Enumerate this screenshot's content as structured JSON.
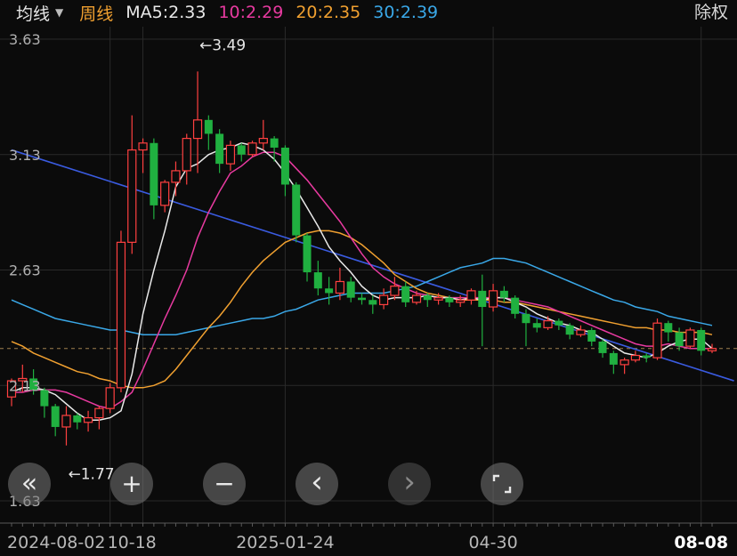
{
  "header": {
    "mode_label": "均线",
    "period_label": "周线",
    "ma_items": [
      {
        "label": "MA5:2.33",
        "color": "#e9e9e9"
      },
      {
        "label": "10:2.29",
        "color": "#e83aa0"
      },
      {
        "label": "20:2.35",
        "color": "#f0a030"
      },
      {
        "label": "30:2.39",
        "color": "#3aa8e8"
      }
    ],
    "adjust_label": "除权"
  },
  "chart_data": {
    "type": "candlestick",
    "y_ticks": [
      "3.63",
      "3.13",
      "2.63",
      "2.13",
      "1.63"
    ],
    "ylim": [
      1.63,
      3.63
    ],
    "x_labels": [
      "2024-08-02",
      "10-18",
      "2025-01-24",
      "04-30",
      "08-08"
    ],
    "annotations": [
      {
        "text": "←3.49",
        "value": 3.49
      },
      {
        "text": "←1.77",
        "value": 1.77
      }
    ],
    "reference_line": 2.29,
    "colors": {
      "up": "#ff4040",
      "down": "#20b040",
      "grid": "#2a2a2a"
    },
    "candles": [
      [
        2.08,
        2.15,
        2.16,
        2.04
      ],
      [
        2.15,
        2.16,
        2.22,
        2.1
      ],
      [
        2.16,
        2.11,
        2.2,
        2.09
      ],
      [
        2.11,
        2.04,
        2.12,
        1.99
      ],
      [
        2.04,
        1.95,
        2.05,
        1.91
      ],
      [
        1.95,
        2.0,
        2.04,
        1.87
      ],
      [
        2.0,
        1.97,
        2.01,
        1.94
      ],
      [
        1.97,
        1.99,
        2.02,
        1.93
      ],
      [
        1.99,
        2.03,
        2.04,
        1.94
      ],
      [
        2.03,
        2.12,
        2.14,
        2.01
      ],
      [
        2.12,
        2.75,
        2.8,
        2.1
      ],
      [
        2.75,
        3.15,
        3.3,
        2.7
      ],
      [
        3.15,
        3.18,
        3.2,
        3.05
      ],
      [
        3.18,
        2.91,
        3.2,
        2.85
      ],
      [
        2.91,
        3.01,
        3.02,
        2.88
      ],
      [
        3.01,
        3.06,
        3.1,
        2.95
      ],
      [
        3.06,
        3.2,
        3.22,
        3.0
      ],
      [
        3.2,
        3.28,
        3.49,
        3.05
      ],
      [
        3.28,
        3.22,
        3.3,
        3.15
      ],
      [
        3.22,
        3.09,
        3.24,
        3.05
      ],
      [
        3.09,
        3.17,
        3.19,
        3.06
      ],
      [
        3.17,
        3.13,
        3.18,
        3.1
      ],
      [
        3.13,
        3.18,
        3.19,
        3.12
      ],
      [
        3.18,
        3.2,
        3.28,
        3.15
      ],
      [
        3.2,
        3.16,
        3.21,
        3.1
      ],
      [
        3.16,
        3.0,
        3.17,
        2.95
      ],
      [
        3.0,
        2.78,
        3.01,
        2.75
      ],
      [
        2.78,
        2.62,
        2.79,
        2.58
      ],
      [
        2.62,
        2.55,
        2.67,
        2.52
      ],
      [
        2.55,
        2.53,
        2.6,
        2.48
      ],
      [
        2.53,
        2.58,
        2.64,
        2.5
      ],
      [
        2.58,
        2.51,
        2.6,
        2.49
      ],
      [
        2.51,
        2.5,
        2.53,
        2.48
      ],
      [
        2.5,
        2.48,
        2.52,
        2.44
      ],
      [
        2.48,
        2.52,
        2.55,
        2.46
      ],
      [
        2.52,
        2.56,
        2.6,
        2.5
      ],
      [
        2.56,
        2.49,
        2.58,
        2.47
      ],
      [
        2.49,
        2.52,
        2.54,
        2.48
      ],
      [
        2.52,
        2.5,
        2.53,
        2.47
      ],
      [
        2.5,
        2.51,
        2.53,
        2.48
      ],
      [
        2.51,
        2.49,
        2.52,
        2.47
      ],
      [
        2.49,
        2.5,
        2.52,
        2.47
      ],
      [
        2.5,
        2.54,
        2.55,
        2.48
      ],
      [
        2.54,
        2.47,
        2.61,
        2.3
      ],
      [
        2.47,
        2.54,
        2.57,
        2.45
      ],
      [
        2.54,
        2.51,
        2.56,
        2.49
      ],
      [
        2.51,
        2.44,
        2.52,
        2.42
      ],
      [
        2.44,
        2.4,
        2.46,
        2.3
      ],
      [
        2.4,
        2.38,
        2.42,
        2.36
      ],
      [
        2.38,
        2.41,
        2.43,
        2.37
      ],
      [
        2.41,
        2.39,
        2.42,
        2.37
      ],
      [
        2.39,
        2.35,
        2.4,
        2.33
      ],
      [
        2.35,
        2.37,
        2.39,
        2.34
      ],
      [
        2.37,
        2.32,
        2.38,
        2.3
      ],
      [
        2.32,
        2.27,
        2.33,
        2.25
      ],
      [
        2.27,
        2.22,
        2.28,
        2.18
      ],
      [
        2.22,
        2.24,
        2.25,
        2.18
      ],
      [
        2.24,
        2.26,
        2.28,
        2.23
      ],
      [
        2.26,
        2.25,
        2.27,
        2.23
      ],
      [
        2.25,
        2.4,
        2.42,
        2.24
      ],
      [
        2.4,
        2.36,
        2.41,
        2.32
      ],
      [
        2.36,
        2.3,
        2.38,
        2.28
      ],
      [
        2.3,
        2.37,
        2.38,
        2.29
      ],
      [
        2.37,
        2.28,
        2.38,
        2.26
      ],
      [
        2.28,
        2.29,
        2.31,
        2.27
      ]
    ],
    "ma5": [
      2.1,
      2.12,
      2.12,
      2.11,
      2.09,
      2.05,
      2.01,
      1.98,
      1.98,
      1.99,
      2.02,
      2.18,
      2.44,
      2.63,
      2.8,
      2.99,
      3.07,
      3.09,
      3.13,
      3.15,
      3.16,
      3.18,
      3.17,
      3.15,
      3.11,
      3.05,
      2.98,
      2.9,
      2.82,
      2.73,
      2.67,
      2.62,
      2.56,
      2.52,
      2.5,
      2.51,
      2.51,
      2.51,
      2.52,
      2.51,
      2.51,
      2.5,
      2.51,
      2.5,
      2.51,
      2.51,
      2.49,
      2.47,
      2.44,
      2.42,
      2.4,
      2.39,
      2.37,
      2.36,
      2.33,
      2.3,
      2.27,
      2.26,
      2.25,
      2.27,
      2.3,
      2.32,
      2.33,
      2.33,
      2.29
    ],
    "ma10": [
      2.1,
      2.1,
      2.11,
      2.11,
      2.11,
      2.1,
      2.08,
      2.06,
      2.04,
      2.03,
      2.06,
      2.1,
      2.2,
      2.31,
      2.42,
      2.52,
      2.63,
      2.77,
      2.88,
      2.97,
      3.05,
      3.08,
      3.12,
      3.14,
      3.14,
      3.12,
      3.07,
      3.02,
      2.96,
      2.9,
      2.84,
      2.77,
      2.7,
      2.64,
      2.6,
      2.57,
      2.55,
      2.53,
      2.52,
      2.51,
      2.51,
      2.51,
      2.51,
      2.51,
      2.51,
      2.51,
      2.5,
      2.49,
      2.48,
      2.47,
      2.45,
      2.43,
      2.41,
      2.39,
      2.37,
      2.35,
      2.33,
      2.31,
      2.3,
      2.3,
      2.31,
      2.3,
      2.29,
      2.29,
      2.29
    ],
    "ma20": [
      2.32,
      2.3,
      2.27,
      2.25,
      2.23,
      2.21,
      2.19,
      2.18,
      2.16,
      2.15,
      2.13,
      2.12,
      2.12,
      2.13,
      2.15,
      2.2,
      2.26,
      2.32,
      2.38,
      2.43,
      2.49,
      2.56,
      2.62,
      2.67,
      2.71,
      2.75,
      2.77,
      2.79,
      2.8,
      2.8,
      2.79,
      2.77,
      2.74,
      2.7,
      2.66,
      2.61,
      2.58,
      2.55,
      2.53,
      2.52,
      2.51,
      2.5,
      2.5,
      2.5,
      2.5,
      2.49,
      2.49,
      2.48,
      2.47,
      2.46,
      2.45,
      2.44,
      2.43,
      2.42,
      2.41,
      2.4,
      2.39,
      2.38,
      2.38,
      2.37,
      2.37,
      2.36,
      2.36,
      2.36,
      2.35
    ],
    "ma30": [
      2.5,
      2.48,
      2.46,
      2.44,
      2.42,
      2.41,
      2.4,
      2.39,
      2.38,
      2.37,
      2.37,
      2.36,
      2.35,
      2.35,
      2.35,
      2.35,
      2.36,
      2.37,
      2.38,
      2.39,
      2.4,
      2.41,
      2.42,
      2.42,
      2.43,
      2.45,
      2.46,
      2.48,
      2.5,
      2.51,
      2.52,
      2.53,
      2.53,
      2.53,
      2.53,
      2.54,
      2.55,
      2.56,
      2.58,
      2.6,
      2.62,
      2.64,
      2.65,
      2.66,
      2.68,
      2.68,
      2.67,
      2.66,
      2.64,
      2.62,
      2.6,
      2.58,
      2.56,
      2.54,
      2.52,
      2.5,
      2.49,
      2.47,
      2.46,
      2.45,
      2.43,
      2.42,
      2.41,
      2.4,
      2.39
    ],
    "trendline": {
      "from": [
        0,
        3.15
      ],
      "to": [
        66,
        2.15
      ],
      "color": "#3a5be0"
    }
  },
  "controls": [
    {
      "name": "fast-backward",
      "symbol": "«",
      "disabled": false
    },
    {
      "name": "zoom-in",
      "symbol": "+",
      "disabled": false
    },
    {
      "name": "zoom-out",
      "symbol": "−",
      "disabled": false
    },
    {
      "name": "step-left",
      "symbol": "‹",
      "disabled": false
    },
    {
      "name": "step-right",
      "symbol": "›",
      "disabled": true
    },
    {
      "name": "fullscreen",
      "symbol": "",
      "disabled": false
    }
  ]
}
